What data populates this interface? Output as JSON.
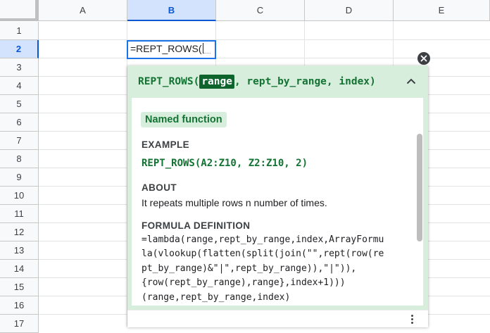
{
  "sheet": {
    "columns": [
      "A",
      "B",
      "C",
      "D",
      "E"
    ],
    "active_column": "B",
    "rows": [
      "1",
      "2",
      "3",
      "4",
      "5",
      "6",
      "7",
      "8",
      "9",
      "10",
      "11",
      "12",
      "13",
      "14",
      "15",
      "16",
      "17"
    ],
    "active_row": "2"
  },
  "cell_editor": {
    "value": "=REPT_ROWS("
  },
  "help_popup": {
    "function_name": "REPT_ROWS(",
    "active_arg": "range",
    "rest_args": ", rept_by_range, index)",
    "badge": "Named function",
    "example_title": "EXAMPLE",
    "example_code": "REPT_ROWS(A2:Z10, Z2:Z10, 2)",
    "about_title": "ABOUT",
    "about_text": "It repeats multiple rows n number of times.",
    "formula_title": "FORMULA DEFINITION",
    "formula_definition": "=lambda(range,rept_by_range,index,ArrayFormu\nla(vlookup(flatten(split(join(\"\",rept(row(re\npt_by_range)&\"|\",rept_by_range)),\"|\")),\n{row(rept_by_range),range},index+1)))\n(range,rept_by_range,index)"
  },
  "icons": {
    "close": "close-circle-icon",
    "collapse": "chevron-up-icon",
    "more": "more-vertical-icon"
  },
  "colors": {
    "accent_green": "#137333",
    "header_green": "#d8eedd",
    "selection_blue": "#1a73e8"
  }
}
